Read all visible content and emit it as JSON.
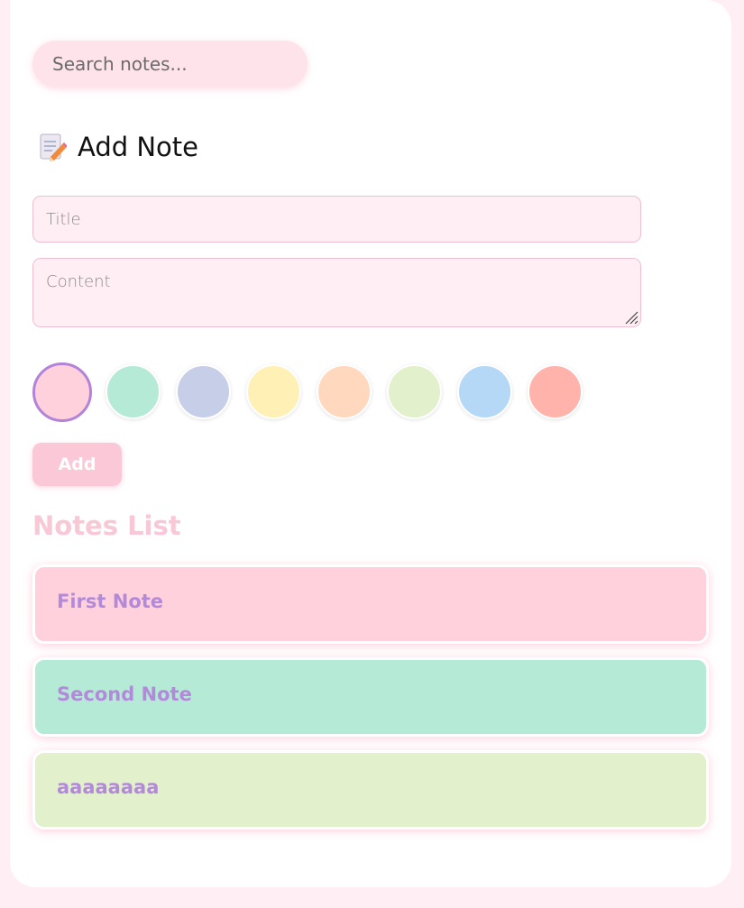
{
  "search": {
    "placeholder": "Search notes..."
  },
  "add_note": {
    "icon": "memo-icon",
    "title": "Add Note",
    "title_placeholder": "Title",
    "content_placeholder": "Content",
    "colors": [
      "#ffd1dc",
      "#b5ead7",
      "#c7cee8",
      "#fff1b6",
      "#ffd8be",
      "#e2f0cb",
      "#b5d8f7",
      "#ffb3ab"
    ],
    "selected_color": "#ffd1dc",
    "add_label": "Add"
  },
  "notes_list": {
    "title": "Notes List",
    "notes": [
      {
        "title": "First Note",
        "color": "#ffd1dc"
      },
      {
        "title": "Second Note",
        "color": "#b5ead7"
      },
      {
        "title": "aaaaaaaa",
        "color": "#e2f0cb"
      }
    ]
  }
}
